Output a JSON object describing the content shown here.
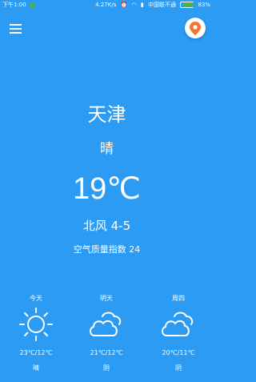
{
  "status_bar": {
    "time": "下午1:00",
    "speed": "4.27K/s",
    "carrier": "中国联不通",
    "battery": "83%",
    "battery_level": 0.83
  },
  "toolbar": {
    "menu_icon": "menu-icon",
    "location_icon": "map-pin-icon",
    "accent_color": "#f4762f"
  },
  "weather": {
    "city": "天津",
    "condition": "晴",
    "temperature": "19℃",
    "wind": "北风 4-5",
    "air_quality": "空气质量指数 24"
  },
  "forecast": [
    {
      "day": "今天",
      "icon": "sun-icon",
      "range": "23℃/12℃",
      "condition": "晴"
    },
    {
      "day": "明天",
      "icon": "cloud-icon",
      "range": "21℃/12℃",
      "condition": "阴"
    },
    {
      "day": "周四",
      "icon": "cloud-icon",
      "range": "20℃/11℃",
      "condition": "阴"
    }
  ],
  "colors": {
    "background": "#2b9bf4",
    "text": "#ffffff"
  }
}
